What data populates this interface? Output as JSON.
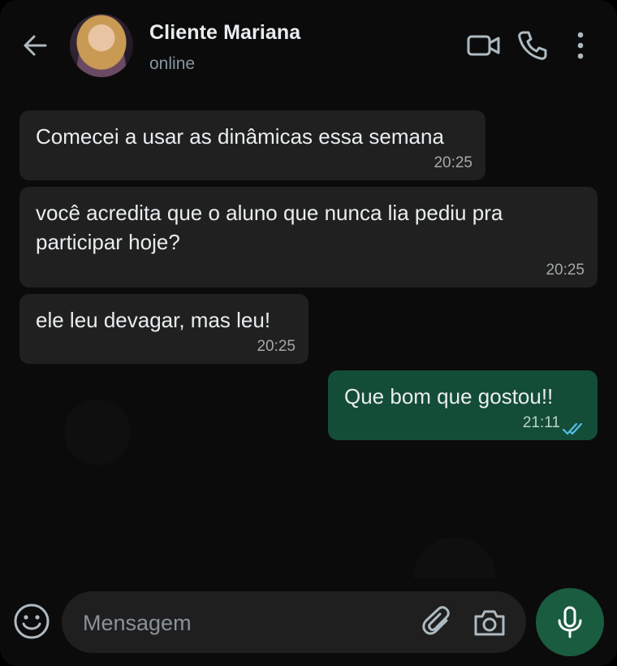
{
  "header": {
    "contact_name": "Cliente Mariana",
    "status": "online",
    "icons": [
      "back-arrow-icon",
      "avatar",
      "video-camera-icon",
      "phone-icon",
      "more-vertical-icon"
    ]
  },
  "messages": [
    {
      "direction": "in",
      "text": "Comecei a usar as dinâmicas essa semana",
      "time": "20:25"
    },
    {
      "direction": "in",
      "text": "você acredita que o aluno que nunca lia pediu pra\nparticipar hoje?",
      "time": "20:25"
    },
    {
      "direction": "in",
      "text": "ele leu devagar, mas leu!",
      "time": "20:25"
    },
    {
      "direction": "out",
      "text": "Que bom que gostou!!",
      "time": "21:11",
      "read": true
    }
  ],
  "composer": {
    "placeholder": "Mensagem",
    "icons": [
      "emoji-icon",
      "paperclip-icon",
      "camera-icon",
      "microphone-icon"
    ]
  },
  "colors": {
    "background": "#0b0b0b",
    "incoming_bubble": "#202020",
    "outgoing_bubble": "#144d37",
    "read_ticks": "#53bdeb",
    "mic_button": "#1a5c40"
  }
}
